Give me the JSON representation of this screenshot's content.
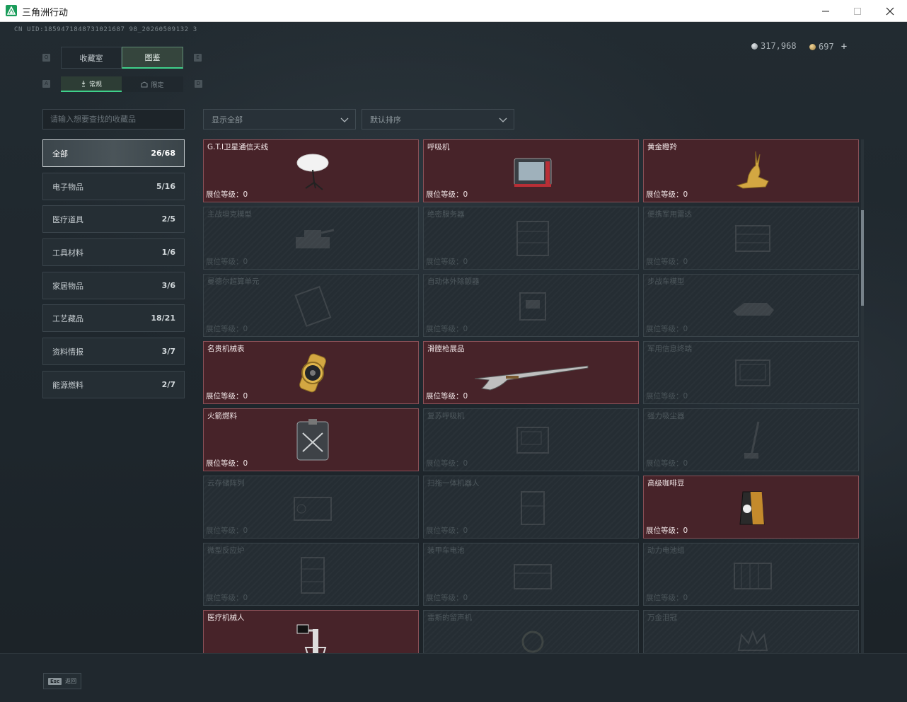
{
  "window": {
    "title": "三角洲行动"
  },
  "header": {
    "uid": "CN UID:1859471848731021687 98_20260509132 3",
    "currency": [
      {
        "value": "317,968",
        "color": "#a9b1b6"
      },
      {
        "value": "697",
        "color": "#d7b06a"
      }
    ],
    "plus": "+"
  },
  "tabs": [
    {
      "label": "收藏室",
      "active": false
    },
    {
      "label": "图鉴",
      "active": true
    }
  ],
  "key_hints": {
    "left_tab": "Q",
    "right_tab": "E",
    "left_sub": "A",
    "right_sub": "D"
  },
  "subtabs": [
    {
      "label": "常规",
      "active": true
    },
    {
      "label": "限定",
      "active": false
    }
  ],
  "search": {
    "placeholder": "请输入想要查找的收藏品",
    "value": ""
  },
  "filters": {
    "display": "显示全部",
    "sort": "默认排序"
  },
  "categories": [
    {
      "label": "全部",
      "count": "26/68",
      "active": true
    },
    {
      "label": "电子物品",
      "count": "5/16"
    },
    {
      "label": "医疗道具",
      "count": "2/5"
    },
    {
      "label": "工具材料",
      "count": "1/6"
    },
    {
      "label": "家居物品",
      "count": "3/6"
    },
    {
      "label": "工艺藏品",
      "count": "18/21"
    },
    {
      "label": "资料情报",
      "count": "3/7"
    },
    {
      "label": "能源燃料",
      "count": "2/7"
    }
  ],
  "level_label": "展位等级：",
  "items": [
    {
      "name": "G.T.I卫星通信天线",
      "level": "0",
      "owned": true,
      "icon": "satellite-dish-icon"
    },
    {
      "name": "呼吸机",
      "level": "0",
      "owned": true,
      "icon": "ventilator-icon"
    },
    {
      "name": "黄金瞪羚",
      "level": "0",
      "owned": true,
      "icon": "gold-gazelle-icon"
    },
    {
      "name": "主战坦克模型",
      "level": "0",
      "owned": false,
      "icon": "tank-model-icon"
    },
    {
      "name": "绝密服务器",
      "level": "0",
      "owned": false,
      "icon": "server-icon"
    },
    {
      "name": "便携军用雷达",
      "level": "0",
      "owned": false,
      "icon": "radar-icon"
    },
    {
      "name": "曼德尔超算单元",
      "level": "0",
      "owned": false,
      "icon": "supercomputer-icon"
    },
    {
      "name": "自动体外除颤器",
      "level": "0",
      "owned": false,
      "icon": "defibrillator-icon"
    },
    {
      "name": "步战车模型",
      "level": "0",
      "owned": false,
      "icon": "ifv-model-icon"
    },
    {
      "name": "名贵机械表",
      "level": "0",
      "owned": true,
      "icon": "watch-icon"
    },
    {
      "name": "滑膛枪展品",
      "level": "0",
      "owned": true,
      "icon": "musket-icon"
    },
    {
      "name": "军用信息终端",
      "level": "0",
      "owned": false,
      "icon": "terminal-icon"
    },
    {
      "name": "火箭燃料",
      "level": "0",
      "owned": true,
      "icon": "fuel-canister-icon"
    },
    {
      "name": "复苏呼吸机",
      "level": "0",
      "owned": false,
      "icon": "resuscitator-icon"
    },
    {
      "name": "强力吸尘器",
      "level": "0",
      "owned": false,
      "icon": "vacuum-icon"
    },
    {
      "name": "云存储阵列",
      "level": "0",
      "owned": false,
      "icon": "storage-array-icon"
    },
    {
      "name": "扫拖一体机器人",
      "level": "0",
      "owned": false,
      "icon": "robot-vacuum-icon"
    },
    {
      "name": "高级咖啡豆",
      "level": "0",
      "owned": true,
      "icon": "coffee-bag-icon"
    },
    {
      "name": "微型反应炉",
      "level": "0",
      "owned": false,
      "icon": "reactor-icon"
    },
    {
      "name": "装甲车电池",
      "level": "0",
      "owned": false,
      "icon": "battery-icon"
    },
    {
      "name": "动力电池组",
      "level": "0",
      "owned": false,
      "icon": "battery-pack-icon"
    },
    {
      "name": "医疗机械人",
      "level": "",
      "owned": true,
      "icon": "medical-robot-icon"
    },
    {
      "name": "雷斯的留声机",
      "level": "",
      "owned": false,
      "icon": "gramophone-icon"
    },
    {
      "name": "万金泪冠",
      "level": "",
      "owned": false,
      "icon": "crown-icon"
    }
  ],
  "footer": {
    "esc_key": "Esc",
    "back_label": "返回"
  }
}
